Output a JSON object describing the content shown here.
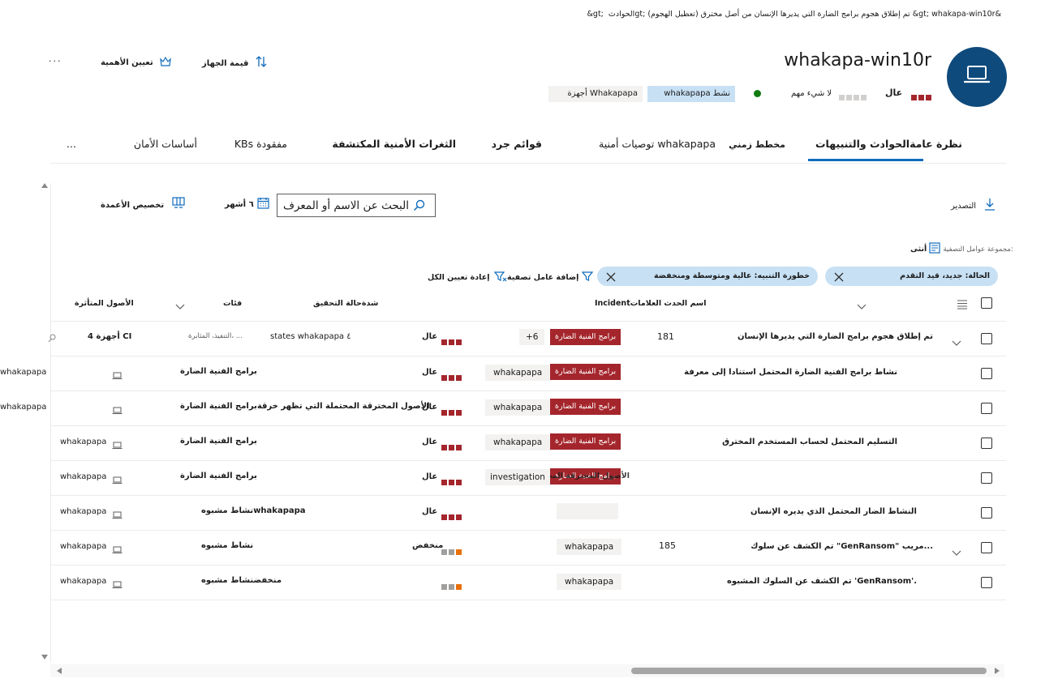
{
  "breadcrumb": {
    "text": "&gt; الحوادث  ‏gt;‎  تم إطلاق هجوم برامج الضارة التي يديرها الإنسان من أصل مخترق (تعطيل الهجوم)  &gt; whakapa-win10r&"
  },
  "header": {
    "device_name": "whakapa-win10r",
    "device_icon": "laptop-icon",
    "risk_label": "عال",
    "exposure_label": "لا شيء مهم",
    "status_label": "whakapapa نشط",
    "tag_label": "أجهزة Whakapapa",
    "colors": {
      "accent": "#0f6cbd",
      "avatar": "#0f4a7c",
      "high": "#a4262c",
      "active": "#107c10",
      "medium": "#e8700a"
    }
  },
  "actions": {
    "device_value": "قيمة الجهاز",
    "set_criticality": "تعيين الأهمية",
    "more": "..."
  },
  "tabs": [
    {
      "label": "نظرة عامةالحوادث والتنبيهات",
      "active": true
    },
    {
      "label": "مخطط زمني"
    },
    {
      "label": "توصيات أمنية whakapapa"
    },
    {
      "label": "قوائم جرد"
    },
    {
      "label": "الثغرات الأمنية المكتشفة"
    },
    {
      "label": "KBs مفقودة"
    },
    {
      "label": "أساسات الأمان"
    },
    {
      "label": "..."
    }
  ],
  "toolbar": {
    "export": "التصدير",
    "search_placeholder": "البحث عن الاسم أو المعرف",
    "date_range": "٦ أشهر",
    "customize_columns": "تخصيص الأعمدة",
    "filter_set": "مجموعة عوامل التصفية:",
    "filter_set_value": "أنثى",
    "reset_all": "إعادة تعيين الكل",
    "add_filter": "إضافة عامل تصفية"
  },
  "filters": [
    {
      "label": "الحالة: جديد، قيد التقدم"
    },
    {
      "label": "خطورة التنبيه: عالية ومتوسطة ومنخفضة"
    }
  ],
  "columns": {
    "incident": "Incidentاسم الحدث العلامات",
    "investigation_state": "شدةحالة التحقيق",
    "categories": "فئات",
    "impacted_assets": "الأصول المتأثرة"
  },
  "rows": [
    {
      "name": "تم إطلاق هجوم برامج الضارة التي يديرها الإنسان",
      "id": "181",
      "category_tag": "برامج الفنية الضارة",
      "extra": "+6",
      "severity": "عال",
      "investigation": "states whakapapa ٤",
      "categories": "التنفيذ، المثابرة، ...",
      "assets": "أجهزة 4 CI",
      "expandable": true
    },
    {
      "name": "نشاط برامج الفنية الضارة المحتمل استنادا إلى معرفة",
      "category_tag": "برامج الفنية الضارة",
      "entity": "whakapapa",
      "severity": "عال",
      "categories": "برامج الفنية الضارة",
      "assets": "whakapapa"
    },
    {
      "name": "",
      "category_tag": "برامج الفنية الضارة",
      "entity": "whakapapa",
      "severity": "عال",
      "categories": "الأصول المخترقة المحتملة التي تظهر خرقةبرامج الفنية الضارة",
      "assets": "whakapapa"
    },
    {
      "name": "التسليم المحتمل لحساب المستخدم المخترق",
      "category_tag": "برامج الفنية الضارة",
      "entity": "whakapapa",
      "severity": "عال",
      "categories": "برامج الفنية الضارة",
      "assets": "whakapapa"
    },
    {
      "name": "",
      "category_tag": "برامج الفنية الضارة",
      "entity": "investigation",
      "overlap_text": "الأصول المخترقة المحتملة التي تظهر",
      "severity": "عال",
      "categories": "برامج الفنية الضارة",
      "assets": "whakapapa"
    },
    {
      "name": "النشاط الضار المحتمل الذي يديره الإنسان",
      "severity": "عال",
      "categories": "نشاط مشبوهwhakapapa",
      "assets": "whakapapa"
    },
    {
      "name": "تم الكشف عن سلوك \"GenRansom\" مريب...",
      "id": "185",
      "entity": "whakapapa",
      "severity": "منخفض",
      "categories": "نشاط مشبوه",
      "assets": "whakapapa",
      "expandable": true
    },
    {
      "name": "تم الكشف عن السلوك المشبوه 'GenRansom'.",
      "entity": "whakapapa",
      "severity": "",
      "categories": "منخفضنشاط مشبوه",
      "assets": "whakapapa"
    }
  ]
}
